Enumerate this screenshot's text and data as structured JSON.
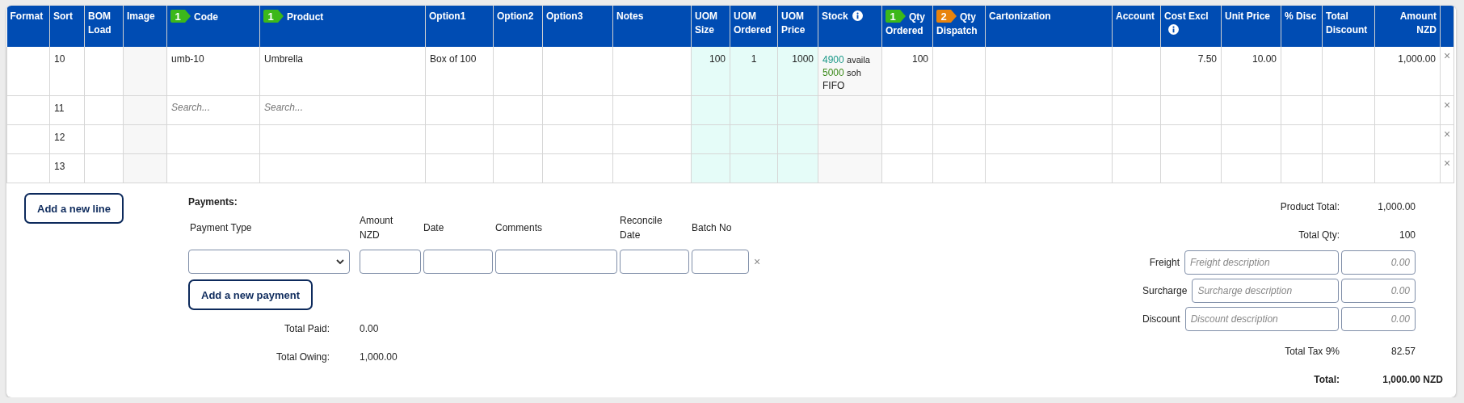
{
  "table": {
    "columns": [
      {
        "label": "Format",
        "kind": "text"
      },
      {
        "label": "Sort",
        "kind": "text"
      },
      {
        "label": "BOM Load",
        "kind": "text"
      },
      {
        "label": "Image",
        "kind": "image"
      },
      {
        "label": "Code",
        "kind": "text",
        "badge": {
          "number": "1",
          "color": "#3cb81a"
        }
      },
      {
        "label": "Product",
        "kind": "text",
        "badge": {
          "number": "1",
          "color": "#3cb81a"
        }
      },
      {
        "label": "Option1",
        "kind": "text"
      },
      {
        "label": "Option2",
        "kind": "text"
      },
      {
        "label": "Option3",
        "kind": "text"
      },
      {
        "label": "Notes",
        "kind": "text"
      },
      {
        "label": "UOM Size",
        "kind": "uom"
      },
      {
        "label": "UOM Ordered",
        "kind": "uom-center"
      },
      {
        "label": "UOM Price",
        "kind": "uom"
      },
      {
        "label": "Stock",
        "kind": "stock",
        "info": true
      },
      {
        "label": "Qty Ordered",
        "kind": "number",
        "badge": {
          "number": "1",
          "color": "#3cb81a"
        }
      },
      {
        "label": "Qty Dispatch",
        "kind": "number",
        "badge": {
          "number": "2",
          "color": "#e8830c"
        }
      },
      {
        "label": "Cartonization",
        "kind": "text"
      },
      {
        "label": "Account",
        "kind": "text"
      },
      {
        "label": "Cost Excl",
        "kind": "number",
        "info": true
      },
      {
        "label": "Unit Price",
        "kind": "number"
      },
      {
        "label": "% Disc",
        "kind": "number"
      },
      {
        "label": "Total Discount",
        "kind": "number"
      },
      {
        "label": "Amount NZD",
        "kind": "amount"
      }
    ],
    "rows": [
      {
        "remove": "×",
        "sort": "10",
        "code": "umb-10",
        "product": "Umbrella",
        "option1": "Box of 100",
        "uom_size": "100",
        "uom_ordered": "1",
        "uom_price": "1000",
        "stock": {
          "available": "4900",
          "available_label": "availa",
          "soh": "5000",
          "soh_label": "soh",
          "method": "FIFO"
        },
        "qty_ordered": "100",
        "cost_excl": "7.50",
        "unit_price": "10.00",
        "amount": "1,000.00"
      },
      {
        "remove": "×",
        "sort": "11",
        "code": {
          "placeholder": "Search..."
        },
        "product": {
          "placeholder": "Search..."
        }
      },
      {
        "remove": "×",
        "sort": "12"
      },
      {
        "remove": "×",
        "sort": "13"
      }
    ]
  },
  "add_line_button": "Add a new line",
  "payments": {
    "title": "Payments:",
    "columns": [
      "Payment Type",
      "Amount NZD",
      "Date",
      "Comments",
      "Reconcile Date",
      "Batch No"
    ],
    "rows": [
      {
        "remove": "×"
      }
    ],
    "add_button": "Add a new payment",
    "totals": [
      {
        "label": "Total Paid:",
        "value": "0.00"
      },
      {
        "label": "Total Owing:",
        "value": "1,000.00"
      }
    ]
  },
  "summary": {
    "lines_top": [
      {
        "label": "Product Total:",
        "value": "1,000.00"
      },
      {
        "label": "Total Qty:",
        "value": "100"
      }
    ],
    "charges": [
      {
        "label": "Freight",
        "placeholder": "Freight description",
        "amount_placeholder": "0.00"
      },
      {
        "label": "Surcharge",
        "placeholder": "Surcharge description",
        "amount_placeholder": "0.00"
      },
      {
        "label": "Discount",
        "placeholder": "Discount description",
        "amount_placeholder": "0.00"
      }
    ],
    "tax": {
      "label": "Total Tax 9%",
      "value": "82.57"
    },
    "total": {
      "label": "Total:",
      "value": "1,000.00 NZD"
    }
  }
}
